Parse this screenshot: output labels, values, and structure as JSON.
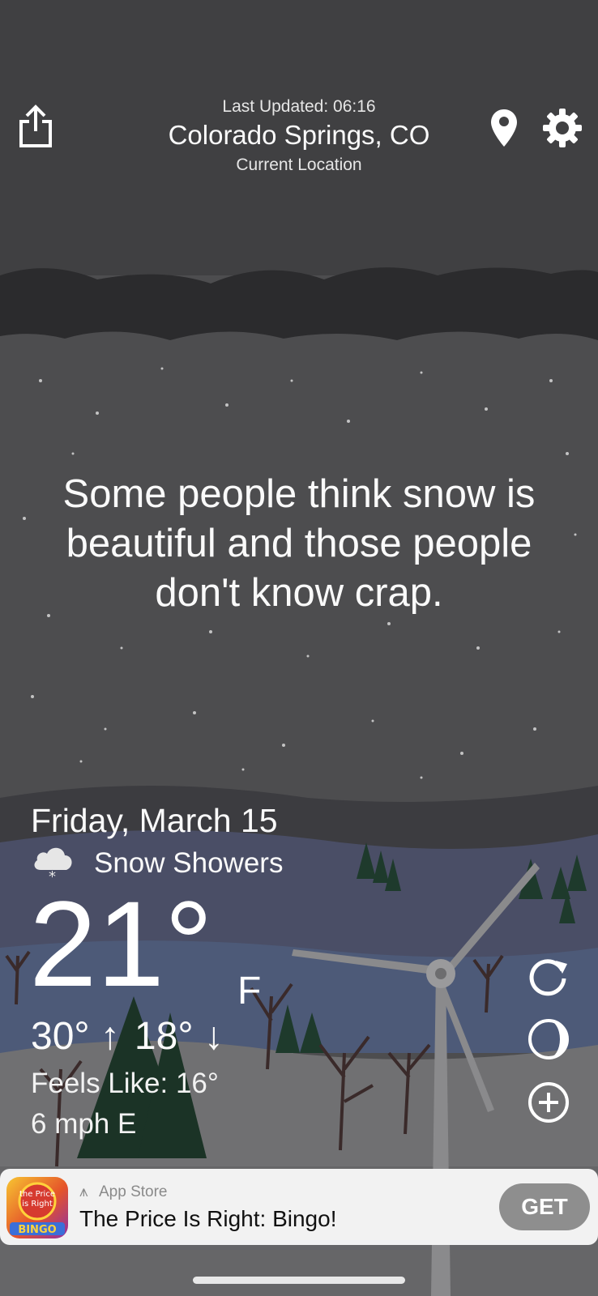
{
  "header": {
    "last_updated": "Last Updated: 06:16",
    "city": "Colorado Springs, CO",
    "location_label": "Current Location",
    "icons": [
      "share-icon",
      "location-pin-icon",
      "settings-gear-icon"
    ]
  },
  "quote": "Some people think snow is beautiful and those people don't know crap.",
  "weather": {
    "date": "Friday, March 15",
    "condition": "Snow Showers",
    "condition_icon": "snow-cloud-icon",
    "temperature": "21°",
    "unit": "F",
    "high": "30° ↑",
    "low": "18° ↓",
    "feels_like": "Feels Like: 16°",
    "wind": "6 mph E"
  },
  "side_actions": [
    "refresh-icon",
    "moon-phase-icon",
    "add-location-icon"
  ],
  "ad": {
    "store_label": "App Store",
    "app_title": "The Price Is Right: Bingo!",
    "button_label": "GET",
    "icon_text": "the Price is Right BINGO"
  },
  "colors": {
    "sky": "#4d4d4f",
    "cloud_band": "#2c2c2e",
    "ground_blue": "#4d5a78",
    "snow": "#6e6e70",
    "tree_green": "#1f3a2a",
    "ad_bg": "#f2f2f2",
    "get_button": "#8e8e8e"
  }
}
